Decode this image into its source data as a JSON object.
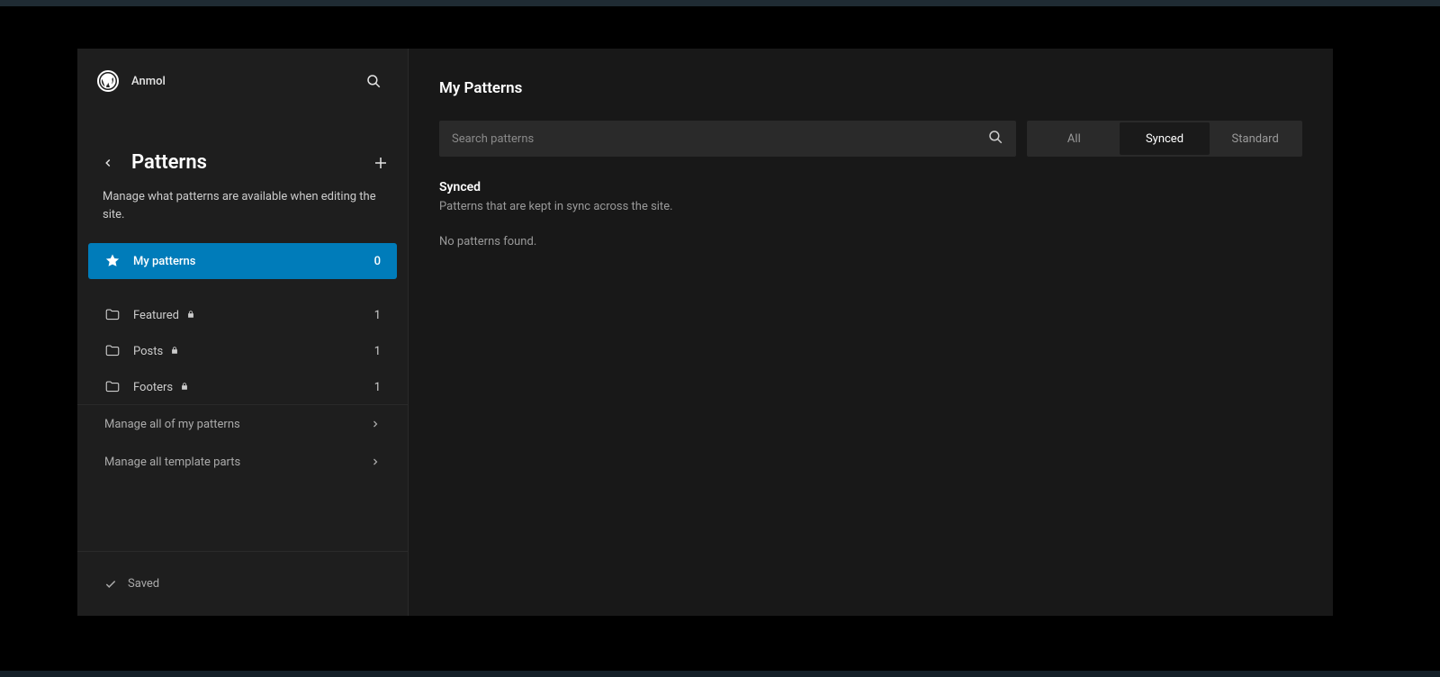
{
  "sidebar": {
    "site_name": "Anmol",
    "section_title": "Patterns",
    "section_desc": "Manage what patterns are available when editing the site.",
    "nav": {
      "my_patterns": {
        "label": "My patterns",
        "count": "0"
      }
    },
    "folders": [
      {
        "label": "Featured",
        "locked": true,
        "count": "1"
      },
      {
        "label": "Posts",
        "locked": true,
        "count": "1"
      },
      {
        "label": "Footers",
        "locked": true,
        "count": "1"
      }
    ],
    "manage": {
      "all_patterns": "Manage all of my patterns",
      "template_parts": "Manage all template parts"
    },
    "saved_label": "Saved"
  },
  "main": {
    "title": "My Patterns",
    "search_placeholder": "Search patterns",
    "filters": {
      "all": "All",
      "synced": "Synced",
      "standard": "Standard"
    },
    "result_heading": "Synced",
    "result_desc": "Patterns that are kept in sync across the site.",
    "empty_text": "No patterns found."
  }
}
